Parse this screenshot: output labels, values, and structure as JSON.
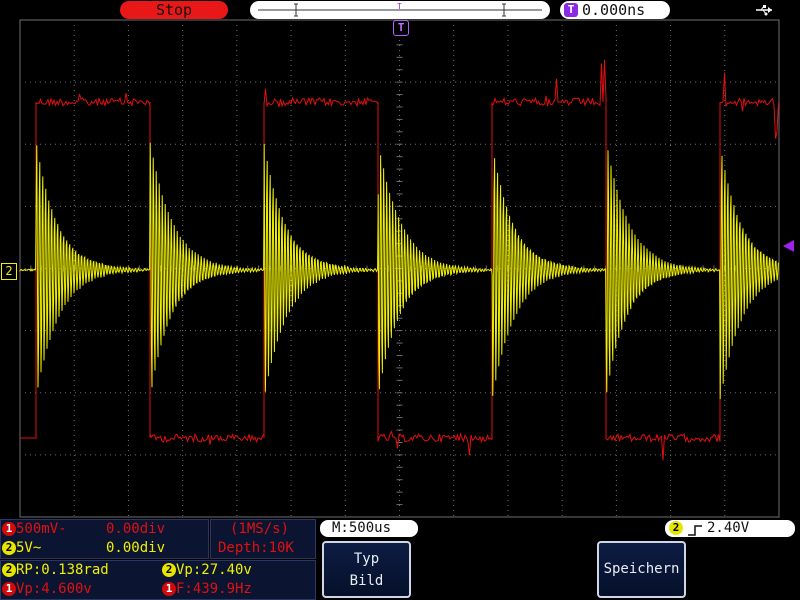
{
  "colors": {
    "ch1": "#e01010",
    "ch2": "#f0f000",
    "trigger": "#8a2be2",
    "grid": "#6e6e6e",
    "panel": "#0b1532"
  },
  "top_bar": {
    "run_state": "Stop",
    "trigger_marker_icon": "trigger-t-icon",
    "trigger_time": "0.000ns",
    "trigger_time_badge": "T",
    "usb_icon": "usb-icon"
  },
  "markers": {
    "top_trigger": "T",
    "ch2_level": "2",
    "trigger_level_icon": "left-arrow-trigger-icon"
  },
  "channels": {
    "ch1": {
      "badge": "1",
      "scale": "500mV-",
      "position": "0.00div"
    },
    "ch2": {
      "badge": "2",
      "scale": "5V~",
      "position": "0.00div"
    }
  },
  "acquisition": {
    "sample_rate": "(1MS/s)",
    "depth": "Depth:10K"
  },
  "timebase": "M:500us",
  "trigger": {
    "badge": "2",
    "slope_icon": "rising-edge-icon",
    "level": "2.40V"
  },
  "measurements": [
    {
      "badge": "2",
      "text": "RP:0.138rad"
    },
    {
      "badge": "2",
      "text": "Vp:27.40v"
    },
    {
      "badge": "1",
      "text": "Vp:4.600v"
    },
    {
      "badge": "1",
      "text": "F:439.9Hz"
    }
  ],
  "buttons": {
    "typ_label": "Typ",
    "typ_value": "Bild",
    "save_label": "Speichern"
  },
  "chart_data": {
    "type": "line",
    "grid": true,
    "divisions": {
      "x": 14,
      "y": 8
    },
    "series": [
      {
        "name": "CH1",
        "kind": "square",
        "frequency_hz": 439.9,
        "vp": 4.6
      },
      {
        "name": "CH2",
        "kind": "decaying-oscillation",
        "vp": 27.4
      }
    ]
  }
}
